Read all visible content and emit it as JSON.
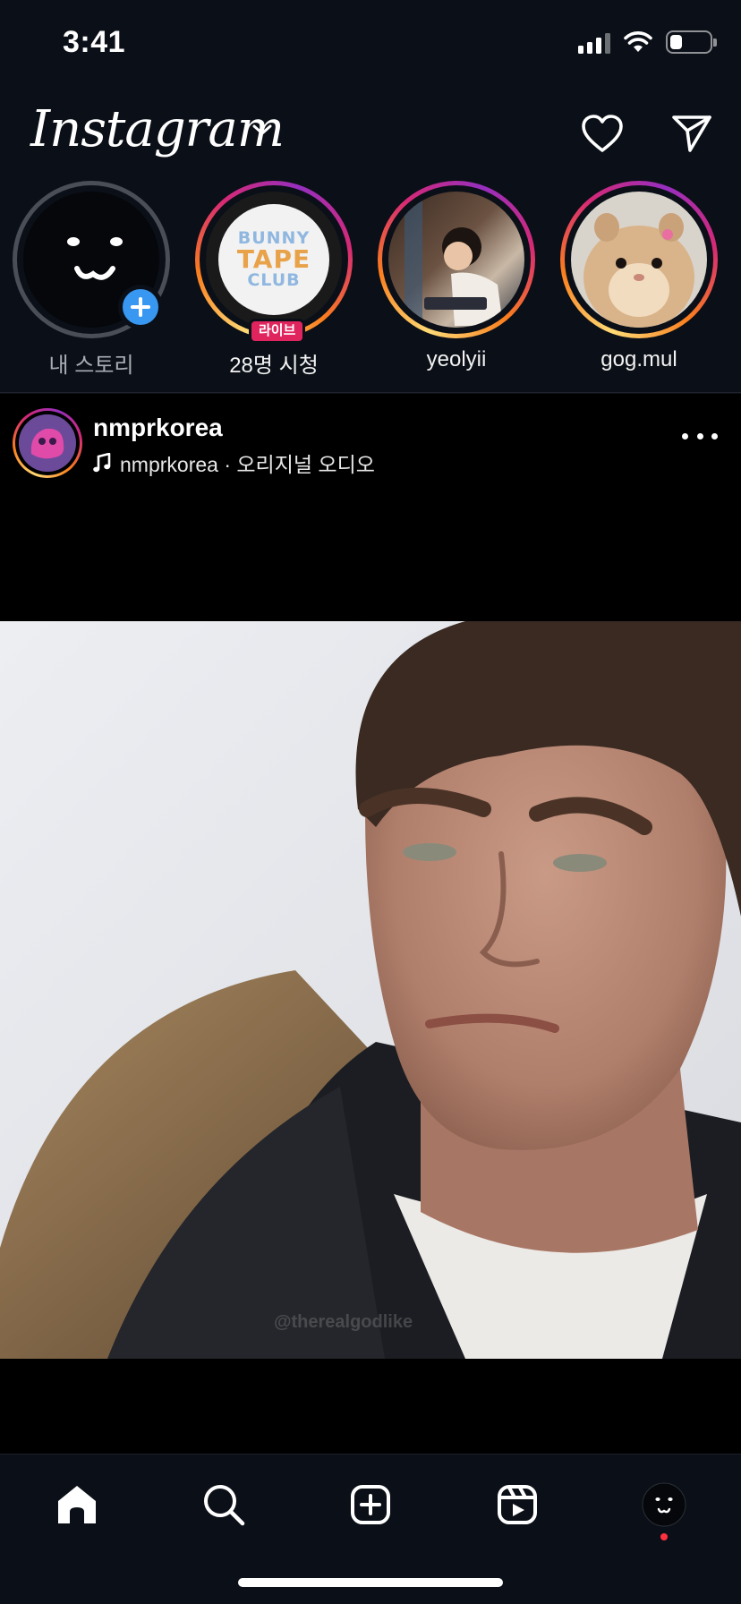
{
  "status_bar": {
    "time": "3:41",
    "battery_level": 0.3
  },
  "header": {
    "logo": "Instagram",
    "icons": [
      "chevron-down-icon",
      "heart-icon",
      "paper-plane-icon"
    ]
  },
  "stories": [
    {
      "label": "내 스토리",
      "type": "own",
      "badge_icon": "plus-icon"
    },
    {
      "label": "28명 시청",
      "type": "live",
      "badge": "라이브",
      "image_text": [
        "BUNNY",
        "TAPE",
        "CLUB"
      ]
    },
    {
      "label": "yeolyii",
      "type": "unseen"
    },
    {
      "label": "gog.mul",
      "type": "unseen"
    }
  ],
  "post": {
    "username": "nmprkorea",
    "audio_text": "nmprkorea · 오리지널 오디오",
    "audio_icon": "music-note-icon",
    "watermark": "@therealgodlike"
  },
  "tab_bar": {
    "items": [
      "home-icon",
      "search-icon",
      "create-icon",
      "reels-icon",
      "profile-icon"
    ],
    "notification_color": "#ff3040"
  },
  "colors": {
    "background": "#0b0f17",
    "accent_blue": "#3897f0",
    "live_red": "#e0245e"
  }
}
